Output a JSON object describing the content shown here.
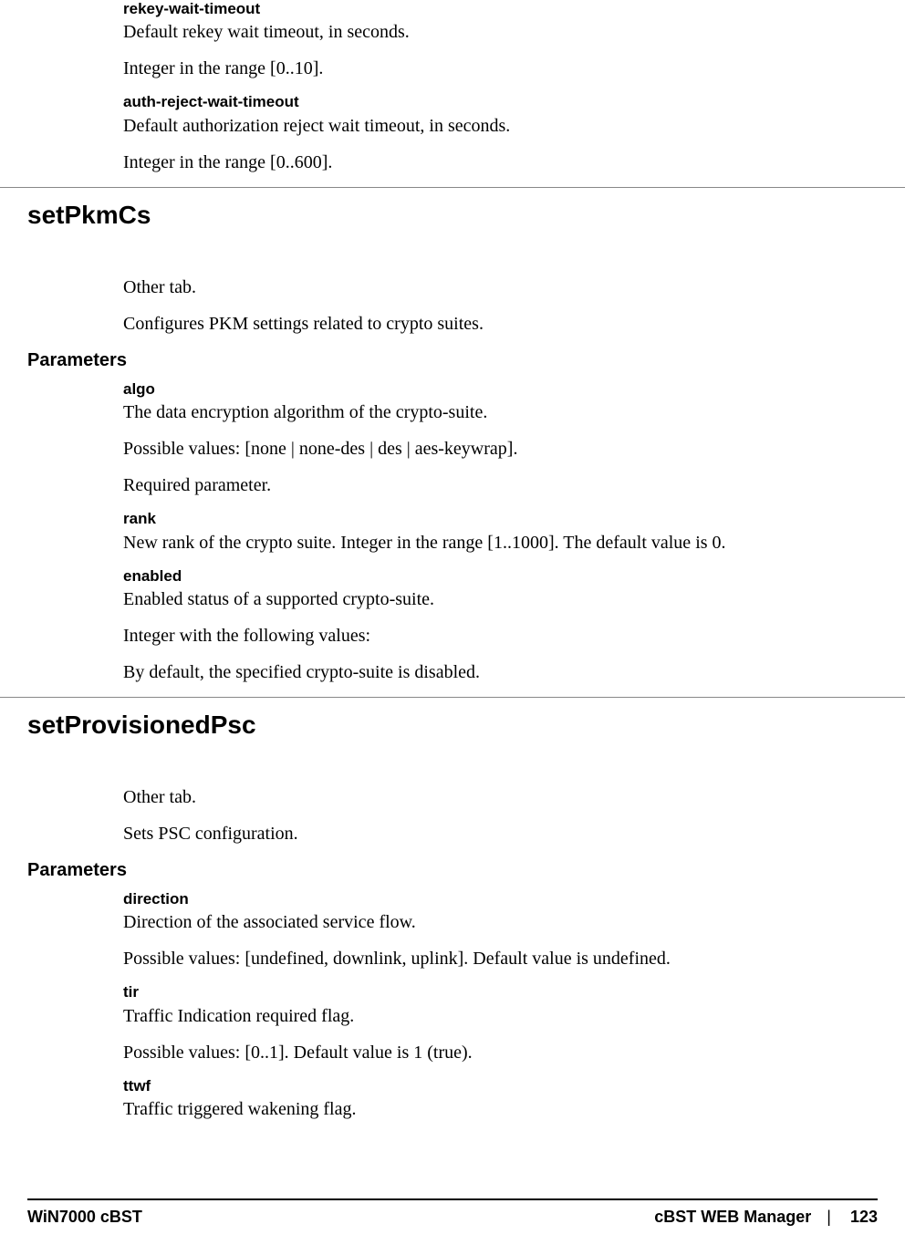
{
  "top": {
    "p1_name": "rekey-wait-timeout",
    "p1_desc": "Default rekey wait timeout, in seconds.",
    "p1_range": "Integer in the range [0..10].",
    "p2_name": "auth-reject-wait-timeout",
    "p2_desc": "Default authorization reject wait timeout, in seconds.",
    "p2_range": "Integer in the range [0..600]."
  },
  "sec1": {
    "title": "setPkmCs",
    "tab": "Other tab.",
    "desc": "Configures PKM settings related to crypto suites.",
    "params_label": "Parameters",
    "algo_name": "algo",
    "algo_desc": "The data encryption algorithm of the crypto-suite.",
    "algo_values": "Possible values: [none | none-des | des | aes-keywrap].",
    "algo_req": "Required parameter.",
    "rank_name": "rank",
    "rank_desc": "New rank of the crypto suite. Integer in the range [1..1000]. The default value is 0.",
    "enabled_name": "enabled",
    "enabled_desc": "Enabled status of a supported crypto-suite.",
    "enabled_int": "Integer with the following values:",
    "enabled_def": "By default, the specified crypto-suite is disabled."
  },
  "sec2": {
    "title": "setProvisionedPsc",
    "tab": "Other tab.",
    "desc": "Sets PSC configuration.",
    "params_label": "Parameters",
    "direction_name": "direction",
    "direction_desc": "Direction of the associated service flow.",
    "direction_values": "Possible values: [undefined, downlink, uplink]. Default value is undefined.",
    "tir_name": "tir",
    "tir_desc": "Traffic Indication required flag.",
    "tir_values": "Possible values: [0..1]. Default value is 1 (true).",
    "ttwf_name": "ttwf",
    "ttwf_desc": "Traffic triggered wakening flag."
  },
  "footer": {
    "left": "WiN7000 cBST",
    "right_title": "cBST WEB Manager",
    "sep": "|",
    "page": "123"
  }
}
